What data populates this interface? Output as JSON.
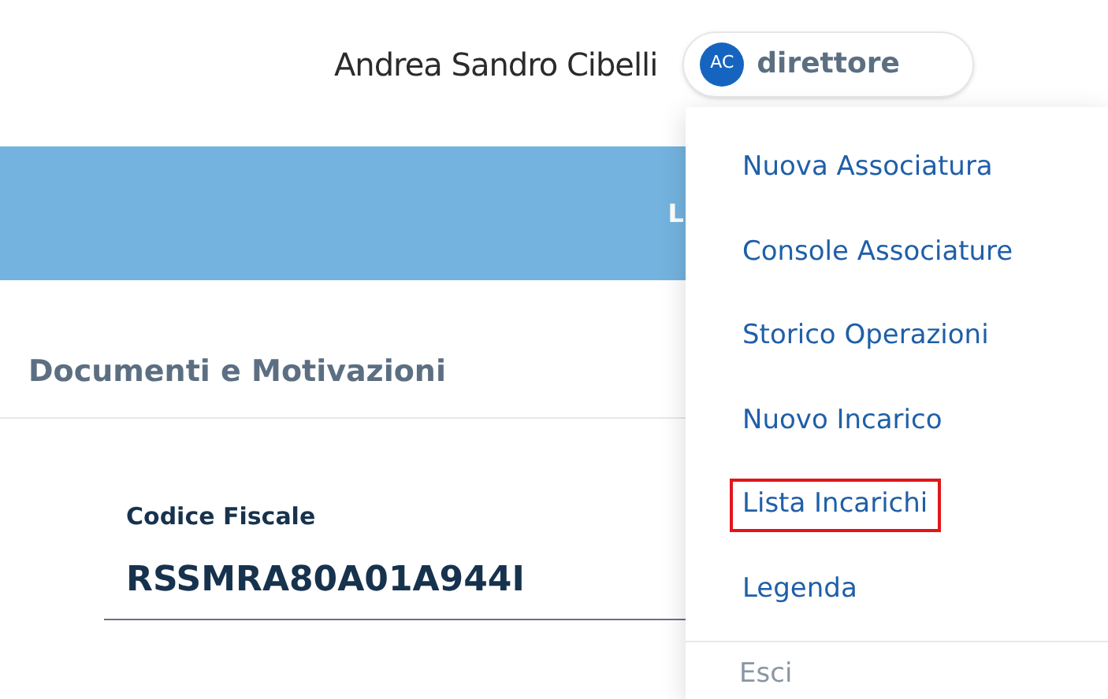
{
  "header": {
    "user_name": "Andrea Sandro Cibelli",
    "avatar_initials": "AC",
    "role": "direttore"
  },
  "banner": {
    "text": "L"
  },
  "section": {
    "title": "Documenti e Motivazioni"
  },
  "field": {
    "label": "Codice Fiscale",
    "value": "RSSMRA80A01A944I"
  },
  "menu": {
    "items": [
      {
        "label": "Nuova Associatura",
        "highlighted": false,
        "disabled": false
      },
      {
        "label": "Console Associature",
        "highlighted": false,
        "disabled": false
      },
      {
        "label": "Storico Operazioni",
        "highlighted": false,
        "disabled": false
      },
      {
        "label": "Nuovo Incarico",
        "highlighted": false,
        "disabled": false
      },
      {
        "label": "Lista Incarichi",
        "highlighted": true,
        "disabled": false
      },
      {
        "label": "Legenda",
        "highlighted": false,
        "disabled": false
      }
    ],
    "footer_item": {
      "label": "Esci",
      "disabled": true
    }
  }
}
